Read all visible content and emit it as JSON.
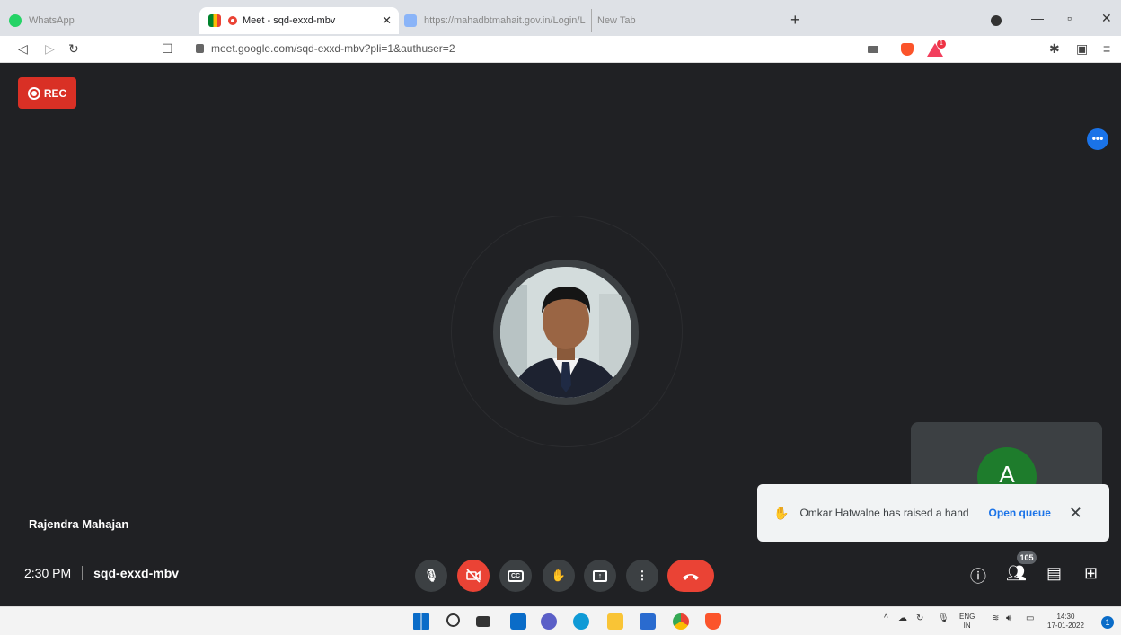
{
  "browser": {
    "tabs": [
      {
        "label": "WhatsApp"
      },
      {
        "label": "Meet - sqd-exxd-mbv"
      },
      {
        "label": "https://mahadbtmahait.gov.in/Login/L"
      },
      {
        "label": "New Tab"
      }
    ],
    "url": "meet.google.com/sqd-exxd-mbv?pli=1&authuser=2",
    "rewards_badge": "1"
  },
  "meet": {
    "rec_label": "REC",
    "more_label": "•••",
    "speaker_name": "Rajendra Mahajan",
    "tile_initial": "A",
    "toast": {
      "message": "Omkar Hatwalne has raised a hand",
      "action": "Open queue"
    },
    "time": "2:30 PM",
    "meeting_code": "sqd-exxd-mbv",
    "controls": {
      "cc": "CC",
      "more": "⋮"
    },
    "participant_count": "105"
  },
  "taskbar": {
    "lang_top": "ENG",
    "lang_bottom": "IN",
    "clock_time": "14:30",
    "clock_date": "17-01-2022",
    "notification_count": "1"
  },
  "colors": {
    "stage": "#202124",
    "rec": "#d93025",
    "hangup": "#ea4335",
    "link": "#1a73e8",
    "avatar_tile": "#1e7c2c"
  }
}
